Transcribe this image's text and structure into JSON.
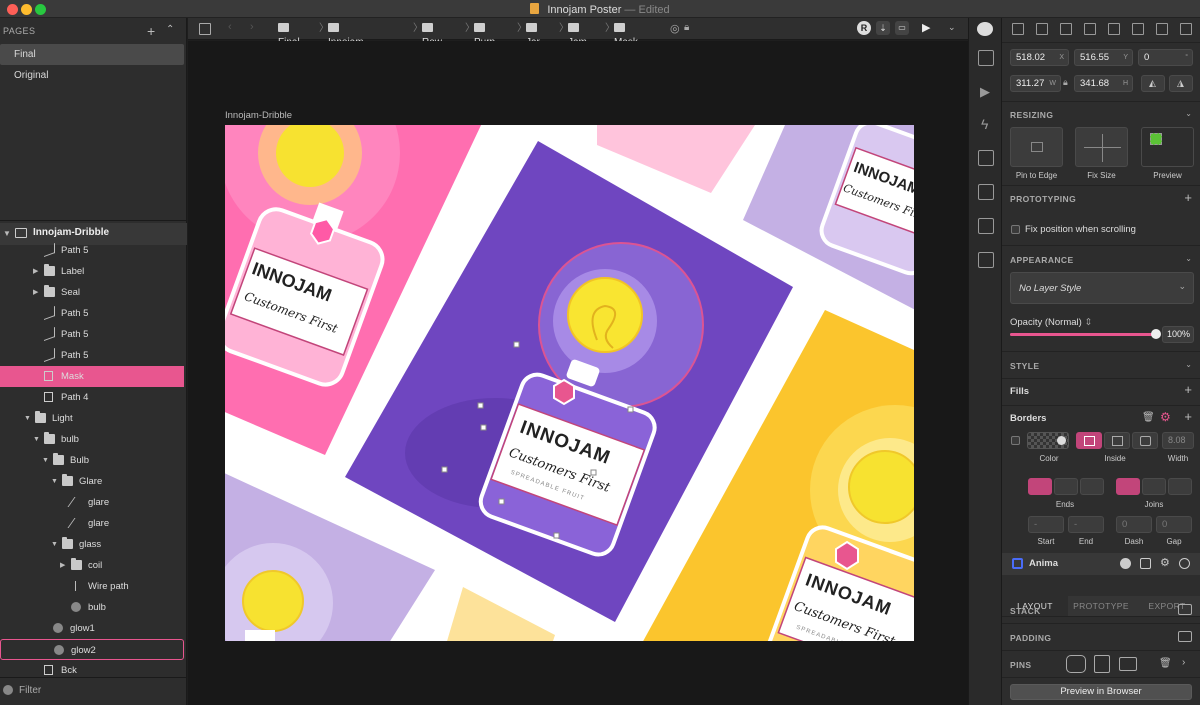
{
  "window": {
    "title": "Innojam Poster",
    "status": "— Edited"
  },
  "pages": {
    "header": "PAGES",
    "items": [
      "Final",
      "Original"
    ],
    "selected": "Final"
  },
  "layers": {
    "root": "Innojam-Dribble",
    "items": [
      {
        "label": "Path 5",
        "depth": 3,
        "kind": "path",
        "expand": false
      },
      {
        "label": "Label",
        "depth": 3,
        "kind": "folder",
        "expand": "closed"
      },
      {
        "label": "Seal",
        "depth": 3,
        "kind": "folder",
        "expand": "closed"
      },
      {
        "label": "Path 5",
        "depth": 3,
        "kind": "path"
      },
      {
        "label": "Path 5",
        "depth": 3,
        "kind": "path"
      },
      {
        "label": "Path 5",
        "depth": 3,
        "kind": "path"
      },
      {
        "label": "Mask",
        "depth": 3,
        "kind": "mask",
        "state": "selected"
      },
      {
        "label": "Path 4",
        "depth": 3,
        "kind": "rect"
      },
      {
        "label": "Light",
        "depth": 2,
        "kind": "folder",
        "expand": "open"
      },
      {
        "label": "bulb",
        "depth": 3,
        "kind": "folder",
        "expand": "open"
      },
      {
        "label": "Bulb",
        "depth": 4,
        "kind": "folder",
        "expand": "open"
      },
      {
        "label": "Glare",
        "depth": 5,
        "kind": "folder",
        "expand": "open"
      },
      {
        "label": "glare",
        "depth": 6,
        "kind": "line"
      },
      {
        "label": "glare",
        "depth": 6,
        "kind": "line"
      },
      {
        "label": "glass",
        "depth": 5,
        "kind": "folder",
        "expand": "open"
      },
      {
        "label": "coil",
        "depth": 6,
        "kind": "folder",
        "expand": "closed"
      },
      {
        "label": "Wire path",
        "depth": 6,
        "kind": "wire"
      },
      {
        "label": "bulb",
        "depth": 6,
        "kind": "oval"
      },
      {
        "label": "glow1",
        "depth": 4,
        "kind": "oval"
      },
      {
        "label": "glow2",
        "depth": 4,
        "kind": "oval",
        "state": "hover"
      },
      {
        "label": "Bck",
        "depth": 3,
        "kind": "rect"
      }
    ],
    "filter_label": "Filter"
  },
  "breadcrumb": [
    "Final",
    "Innojam-Dribble",
    "Row",
    "Purp",
    "Jar",
    "Jam",
    "Mask"
  ],
  "canvas": {
    "artboard_label": "Innojam-Dribble",
    "jar_brand": "INNOJAM",
    "jar_tagline": "Customers First",
    "jar_sub": "SPREADABLE FRUIT"
  },
  "inspector": {
    "x": "518.02",
    "x_unit": "X",
    "y": "516.55",
    "y_unit": "Y",
    "rotation": "0",
    "rotation_unit": "°",
    "w": "311.27",
    "w_unit": "W",
    "h": "341.68",
    "h_unit": "H",
    "resizing": {
      "header": "RESIZING",
      "options": [
        "Pin to Edge",
        "Fix Size",
        "Preview"
      ]
    },
    "prototyping": {
      "header": "PROTOTYPING",
      "fix_position": "Fix position when scrolling"
    },
    "appearance": {
      "header": "APPEARANCE",
      "layer_style": "No Layer Style",
      "opacity_label": "Opacity (Normal)",
      "opacity_value": "100%",
      "opacity_fraction": 1.0
    },
    "style": {
      "header": "STYLE",
      "fills": "Fills",
      "borders": "Borders",
      "border_labels": [
        "Color",
        "Inside",
        "Width"
      ],
      "width_value": "8.08",
      "ends_label": "Ends",
      "joins_label": "Joins",
      "dash_labels": [
        "Start",
        "End",
        "Dash",
        "Gap"
      ],
      "start_value": "-",
      "end_value": "-",
      "dash_value": "0",
      "gap_value": "0"
    },
    "anima": {
      "label": "Anima",
      "tabs": [
        "LAYOUT",
        "PROTOTYPE",
        "EXPORT"
      ],
      "active_tab": "LAYOUT",
      "rows": [
        "STACK",
        "PADDING",
        "PINS"
      ],
      "preview_button": "Preview in Browser"
    }
  },
  "colors": {
    "accent": "#e8568f",
    "selected_row": "#e8568f",
    "purple": "#6f46c0",
    "pink": "#ff6eb0",
    "yellow": "#fbc52d",
    "lavender": "#c4b0e4"
  }
}
